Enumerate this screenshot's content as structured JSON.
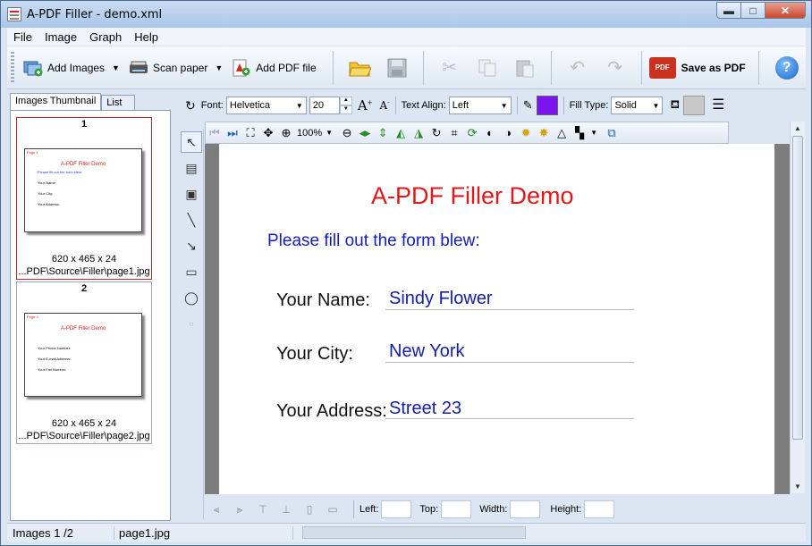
{
  "window": {
    "title": "A-PDF Filler - demo.xml",
    "min_glyph": "▬",
    "max_glyph": "□",
    "close_glyph": "✕"
  },
  "menu": [
    "File",
    "Image",
    "Graph",
    "Help"
  ],
  "toolbar": {
    "add_images": "Add Images",
    "scan_paper": "Scan paper",
    "add_pdf": "Add PDF file",
    "save_as_pdf": "Save as PDF",
    "pdf_badge": "PDF",
    "help": "?"
  },
  "left_panel": {
    "tabs": [
      "Images Thumbnail",
      "List"
    ],
    "thumbnails": [
      {
        "number": "1",
        "dims": "620 x 465 x 24",
        "path": "...PDF\\Source\\Filler\\page1.jpg",
        "mini_title": "A-PDF Filler Demo",
        "mini_sub": "Please fill out the form blew:",
        "mini_lines": [
          "Your Name:",
          "Your City:",
          "Your Address:"
        ],
        "mini_corner": "Page 1"
      },
      {
        "number": "2",
        "dims": "620 x 465 x 24",
        "path": "...PDF\\Source\\Filler\\page2.jpg",
        "mini_title": "A-PDF Filler Demo",
        "mini_sub": "",
        "mini_lines": [
          "Your Phone Number:",
          "Your E-mail Address:",
          "Your Fax Number:"
        ],
        "mini_corner": "Page 2"
      }
    ]
  },
  "format_bar": {
    "font_label": "Font:",
    "font_value": "Helvetica",
    "size_value": "20",
    "text_align_label": "Text Align:",
    "text_align_value": "Left",
    "fill_type_label": "Fill Type:",
    "fill_type_value": "Solid",
    "color_swatch": "#7c14f0",
    "fill_swatch": "#c8c8c8"
  },
  "viewer": {
    "zoom": "100%"
  },
  "document": {
    "title": "A-PDF Filler Demo",
    "subtitle": "Please fill out the form blew:",
    "fields": [
      {
        "label": "Your Name:",
        "value": "Sindy Flower"
      },
      {
        "label": "Your City:",
        "value": "New York"
      },
      {
        "label": "Your Address:",
        "value": "Street 23"
      }
    ]
  },
  "position_bar": {
    "left": "Left:",
    "top": "Top:",
    "width": "Width:",
    "height": "Height:"
  },
  "status": {
    "images": "Images 1 /2",
    "file": "page1.jpg"
  }
}
